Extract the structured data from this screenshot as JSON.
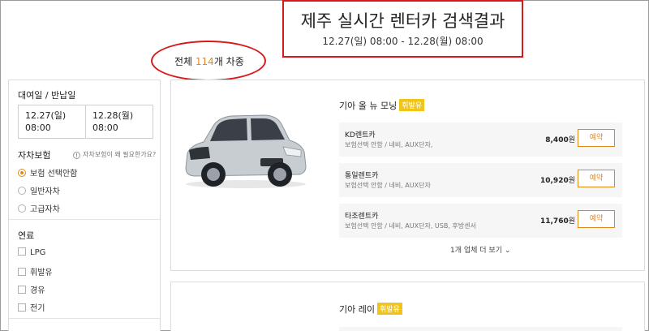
{
  "header": {
    "title": "제주 실시간 렌터카 검색결과",
    "date_range": "12.27(일) 08:00 - 12.28(월) 08:00"
  },
  "summary": {
    "prefix": "전체 ",
    "count": "114",
    "suffix": "개 차종"
  },
  "sidebar": {
    "dates_label": "대여일 / 반납일",
    "pickup": {
      "date": "12.27(일)",
      "time": "08:00"
    },
    "return": {
      "date": "12.28(월)",
      "time": "08:00"
    },
    "insurance_label": "자차보험",
    "insurance_help": "자차보험이 왜 필요한가요?",
    "insurance_options": [
      {
        "label": "보험 선택안함",
        "selected": true
      },
      {
        "label": "일반자차",
        "selected": false
      },
      {
        "label": "고급자차",
        "selected": false
      }
    ],
    "fuel_label": "연료",
    "fuel_options": [
      {
        "label": "LPG"
      },
      {
        "label": "휘발유"
      },
      {
        "label": "경유"
      },
      {
        "label": "전기"
      }
    ]
  },
  "cars": [
    {
      "name": "기아 올 뉴 모닝",
      "fuel": "휘발유",
      "offers": [
        {
          "company": "KD렌트카",
          "options": "보험선택 안함 / 네비, AUX단자,",
          "price": "8,400",
          "unit": "원",
          "button": "예약"
        },
        {
          "company": "통일렌트카",
          "options": "보험선택 안함 / 네비, AUX단자",
          "price": "10,920",
          "unit": "원",
          "button": "예약"
        },
        {
          "company": "타조렌트카",
          "options": "보험선택 안함 / 네비, AUX단자, USB, 후방센서",
          "price": "11,760",
          "unit": "원",
          "button": "예약"
        }
      ],
      "more": "1개 업체 더 보기 ⌄"
    },
    {
      "name": "기아 레이",
      "fuel": "휘발유"
    }
  ],
  "colors": {
    "accent": "#e08a1e",
    "badge": "#f0c419",
    "annotation": "#d7191c",
    "car_body": "#c8cdd2"
  }
}
